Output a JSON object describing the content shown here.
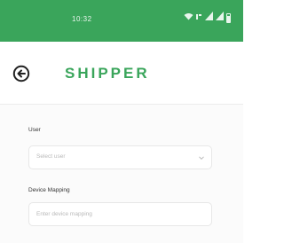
{
  "colors": {
    "accent": "#3aa55b",
    "status_text": "#e8f5ec",
    "border": "#e7e7e7",
    "placeholder": "#b9b9b9"
  },
  "status_bar": {
    "time": "10:32",
    "icons": [
      "wifi-icon",
      "signal-icon",
      "signal-icon",
      "battery-icon"
    ]
  },
  "app_bar": {
    "back_icon": "circle-arrow-left-icon",
    "title": "SHIPPER"
  },
  "form": {
    "user": {
      "label": "User",
      "placeholder": "Select user",
      "icon": "chevron-down-icon"
    },
    "device_mapping": {
      "label": "Device Mapping",
      "placeholder": "Enter device mapping"
    }
  }
}
